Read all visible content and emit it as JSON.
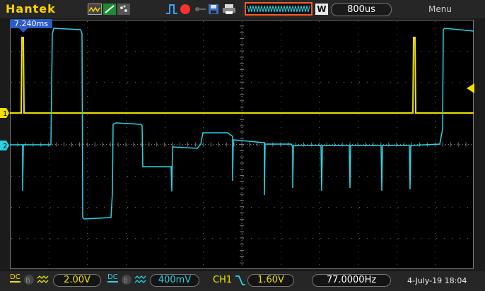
{
  "brand": "Hantek",
  "toolbar": {
    "icons": [
      "waveform-icon",
      "line-display-icon",
      "dot-display-icon",
      "pulse-trigger-icon",
      "run-stop-indicator-icon",
      "key-icon",
      "save-icon",
      "print-icon",
      "memory-depth-icon",
      "window-icon"
    ],
    "window_label": "W",
    "timebase": "800us",
    "menu": "Menu"
  },
  "trigger_time": "7.240ms",
  "channels": {
    "ch1": {
      "marker": "1",
      "color": "#f0e000",
      "volts_div": "2.00V",
      "coupling": "DC"
    },
    "ch2": {
      "marker": "2",
      "color": "#2ad4e4",
      "volts_div": "400mV",
      "coupling": "DC"
    }
  },
  "trigger": {
    "source": "CH1",
    "level": "1.60V",
    "edge": "falling"
  },
  "frequency": "77.0000Hz",
  "datetime": "4-July-19 18:04"
}
